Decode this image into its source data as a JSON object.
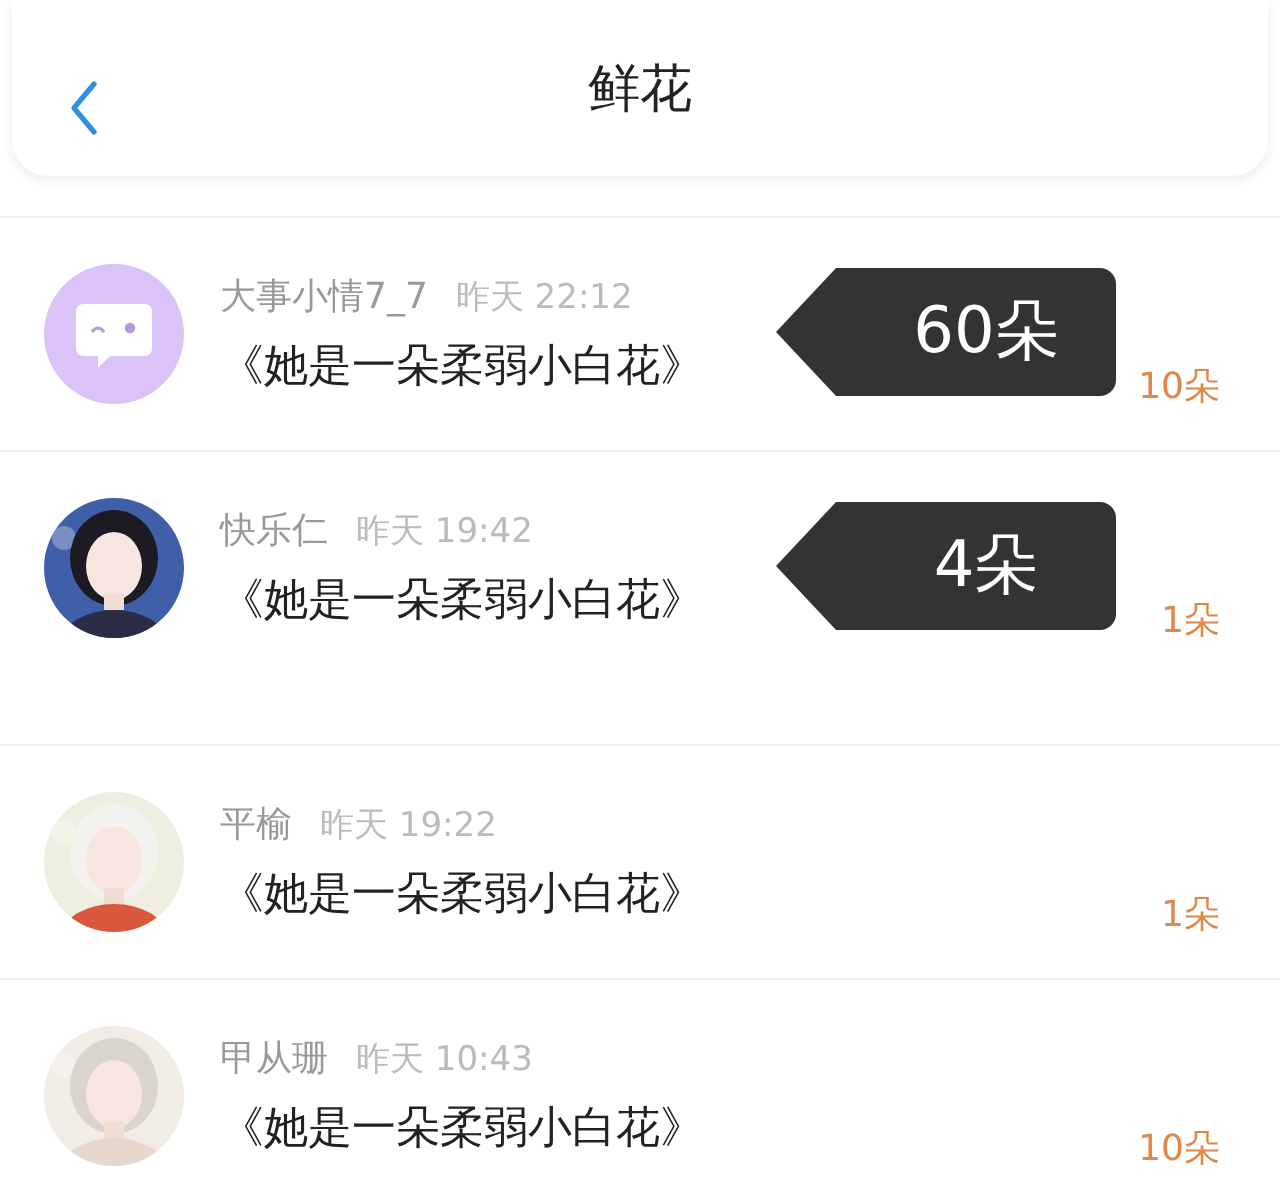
{
  "header": {
    "title": "鲜花"
  },
  "rows": [
    {
      "kind": "icon",
      "name": "大事小情7_7",
      "time": "昨天 22:12",
      "book": "《她是一朵柔弱小白花》",
      "amount": "10朵",
      "tip": "60朵"
    },
    {
      "kind": "picture",
      "name": "快乐仁",
      "time": "昨天 19:42",
      "book": "《她是一朵柔弱小白花》",
      "amount": "1朵",
      "tip": "4朵"
    },
    {
      "kind": "picture",
      "name": "平榆",
      "time": "昨天 19:22",
      "book": "《她是一朵柔弱小白花》",
      "amount": "1朵"
    },
    {
      "kind": "picture",
      "name": "甲从珊",
      "time": "昨天 10:43",
      "book": "《她是一朵柔弱小白花》",
      "amount": "10朵"
    }
  ]
}
